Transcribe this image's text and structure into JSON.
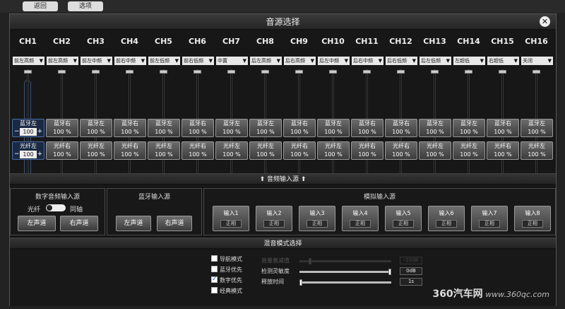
{
  "background": {
    "btn1": "返回",
    "btn2": "选项"
  },
  "dialog": {
    "title": "音源选择",
    "close_icon": "close-icon"
  },
  "channels": [
    {
      "label": "CH1",
      "select": "前左高频",
      "src1": "蓝牙左",
      "val1": "100",
      "src2": "光纤左",
      "val2": "100"
    },
    {
      "label": "CH2",
      "select": "前左高频",
      "src1": "蓝牙右",
      "val1": "100 %",
      "src2": "光纤右",
      "val2": "100 %"
    },
    {
      "label": "CH3",
      "select": "前左中频",
      "src1": "蓝牙左",
      "val1": "100 %",
      "src2": "光纤左",
      "val2": "100 %"
    },
    {
      "label": "CH4",
      "select": "前右中频",
      "src1": "蓝牙右",
      "val1": "100 %",
      "src2": "光纤右",
      "val2": "100 %"
    },
    {
      "label": "CH5",
      "select": "前左低频",
      "src1": "蓝牙左",
      "val1": "100 %",
      "src2": "光纤左",
      "val2": "100 %"
    },
    {
      "label": "CH6",
      "select": "前右低频",
      "src1": "蓝牙右",
      "val1": "100 %",
      "src2": "光纤右",
      "val2": "100 %"
    },
    {
      "label": "CH7",
      "select": "中置",
      "src1": "蓝牙左",
      "val1": "100 %",
      "src2": "光纤左",
      "val2": "100 %"
    },
    {
      "label": "CH8",
      "select": "后左高频",
      "src1": "蓝牙左",
      "val1": "100 %",
      "src2": "光纤左",
      "val2": "100 %"
    },
    {
      "label": "CH9",
      "select": "后右高频",
      "src1": "蓝牙右",
      "val1": "100 %",
      "src2": "光纤右",
      "val2": "100 %"
    },
    {
      "label": "CH10",
      "select": "后左中频",
      "src1": "蓝牙左",
      "val1": "100 %",
      "src2": "光纤左",
      "val2": "100 %"
    },
    {
      "label": "CH11",
      "select": "后右中频",
      "src1": "蓝牙右",
      "val1": "100 %",
      "src2": "光纤右",
      "val2": "100 %"
    },
    {
      "label": "CH12",
      "select": "后右低频",
      "src1": "蓝牙右",
      "val1": "100 %",
      "src2": "光纤右",
      "val2": "100 %"
    },
    {
      "label": "CH13",
      "select": "后左低频",
      "src1": "蓝牙左",
      "val1": "100 %",
      "src2": "光纤左",
      "val2": "100 %"
    },
    {
      "label": "CH14",
      "select": "左超低",
      "src1": "蓝牙左",
      "val1": "100 %",
      "src2": "光纤左",
      "val2": "100 %"
    },
    {
      "label": "CH15",
      "select": "右超低",
      "src1": "蓝牙右",
      "val1": "100 %",
      "src2": "光纤右",
      "val2": "100 %"
    },
    {
      "label": "CH16",
      "select": "关闭",
      "src1": "蓝牙左",
      "val1": "100 %",
      "src2": "光纤左",
      "val2": "100 %"
    }
  ],
  "ch1_controls": {
    "minus": "−",
    "plus": "+"
  },
  "audio_input_header": "音频输入源",
  "digital_panel": {
    "title": "数字音频输入源",
    "toggle_left": "光纤",
    "toggle_right": "同轴",
    "left_btn": "左声道",
    "right_btn": "右声道"
  },
  "bluetooth_panel": {
    "title": "蓝牙输入源",
    "left_btn": "左声道",
    "right_btn": "右声道"
  },
  "analog_panel": {
    "title": "模拟输入源",
    "inputs": [
      {
        "name": "输入1",
        "phase": "正相"
      },
      {
        "name": "输入2",
        "phase": "正相"
      },
      {
        "name": "输入3",
        "phase": "正相"
      },
      {
        "name": "输入4",
        "phase": "正相"
      },
      {
        "name": "输入5",
        "phase": "正相"
      },
      {
        "name": "输入6",
        "phase": "正相"
      },
      {
        "name": "输入7",
        "phase": "正相"
      },
      {
        "name": "输入8",
        "phase": "正相"
      }
    ]
  },
  "mix_header": "混音模式选择",
  "mix_modes": [
    {
      "label": "导航模式",
      "checked": false
    },
    {
      "label": "蓝牙优先",
      "checked": false
    },
    {
      "label": "数字优先",
      "checked": true
    },
    {
      "label": "经典模式",
      "checked": false
    }
  ],
  "mix_sliders": [
    {
      "label": "音量衰减值",
      "value": "-10dB",
      "level": 0.1,
      "disabled": true
    },
    {
      "label": "检测灵敏度",
      "value": "0dB",
      "level": 1.0,
      "disabled": false
    },
    {
      "label": "释放时间",
      "value": "1s",
      "level": 0.0,
      "disabled": false
    }
  ],
  "watermark": {
    "brand": "360汽车网",
    "url": "www.360qc.com"
  },
  "colors": {
    "accent": "#4b6ea8",
    "background": "#151515",
    "button": "#5a5a5a"
  }
}
